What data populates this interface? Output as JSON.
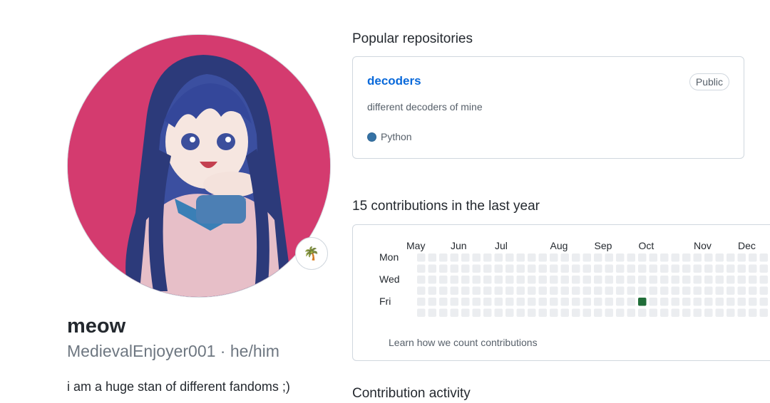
{
  "profile": {
    "display_name": "meow",
    "username": "MedievalEnjoyer001",
    "separator": "·",
    "pronouns": "he/him",
    "bio": "i am a huge stan of different fandoms ;)",
    "status_emoji": "🌴",
    "status_icon": "palm-tree-icon"
  },
  "popular": {
    "title": "Popular repositories",
    "repos": [
      {
        "name": "decoders",
        "visibility": "Public",
        "description": "different decoders of mine",
        "language": "Python",
        "language_color": "#3572A5"
      }
    ]
  },
  "contributions": {
    "title": "15 contributions in the last year",
    "months": [
      "May",
      "Jun",
      "Jul",
      "Aug",
      "Sep",
      "Oct",
      "Nov",
      "Dec"
    ],
    "day_labels": [
      "Mon",
      "Wed",
      "Fri"
    ],
    "learn_link": "Learn how we count contributions",
    "empty_color": "#ebedf0",
    "active_color": "#216e39",
    "active_cells": [
      {
        "week": 20,
        "day": 5,
        "level": 4
      }
    ]
  },
  "activity": {
    "title": "Contribution activity"
  }
}
